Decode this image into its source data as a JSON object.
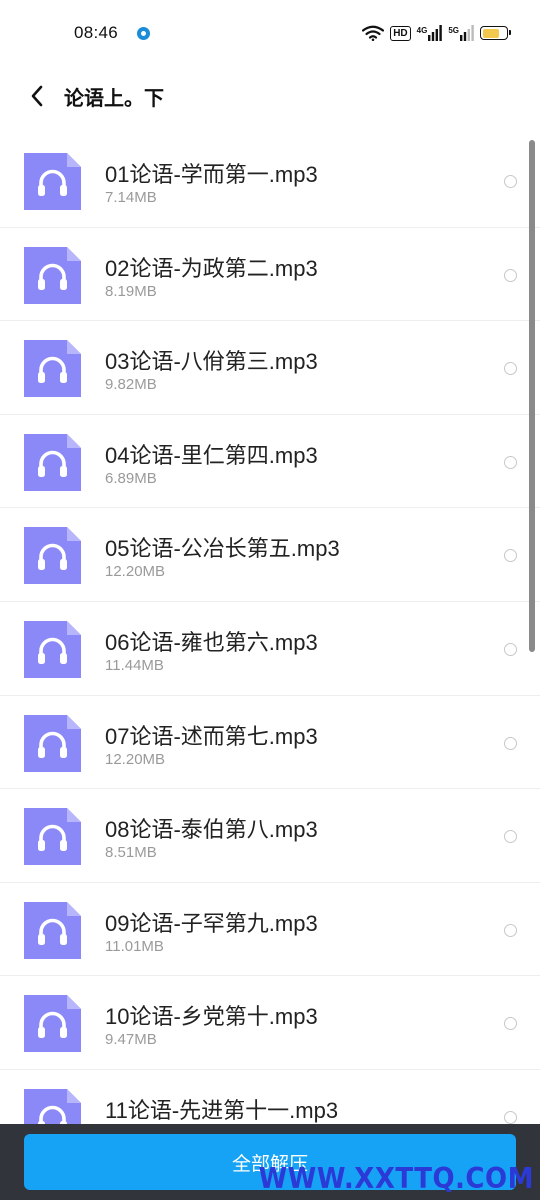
{
  "status_bar": {
    "time": "08:46",
    "network_hd": "HD",
    "network_1": "4G",
    "network_2": "5G",
    "battery_level": 0.7,
    "battery_color": "#f2c94c"
  },
  "header": {
    "back_icon": "chevron-left-icon",
    "title": "论语上。下"
  },
  "files": [
    {
      "name": "01论语-学而第一.mp3",
      "size": "7.14MB"
    },
    {
      "name": "02论语-为政第二.mp3",
      "size": "8.19MB"
    },
    {
      "name": "03论语-八佾第三.mp3",
      "size": "9.82MB"
    },
    {
      "name": "04论语-里仁第四.mp3",
      "size": "6.89MB"
    },
    {
      "name": "05论语-公冶长第五.mp3",
      "size": "12.20MB"
    },
    {
      "name": "06论语-雍也第六.mp3",
      "size": "11.44MB"
    },
    {
      "name": "07论语-述而第七.mp3",
      "size": "12.20MB"
    },
    {
      "name": "08论语-泰伯第八.mp3",
      "size": "8.51MB"
    },
    {
      "name": "09论语-子罕第九.mp3",
      "size": "11.01MB"
    },
    {
      "name": "10论语-乡党第十.mp3",
      "size": "9.47MB"
    },
    {
      "name": "11论语-先进第十一.mp3",
      "size": ""
    }
  ],
  "file_icon": "headphones-audio-file-icon",
  "colors": {
    "file_icon": "#8b88f7",
    "accent_button": "#17a3f5",
    "bottom_bar": "#32343b",
    "watermark": "#2b3ad6"
  },
  "bottom": {
    "extract_all_label": "全部解压"
  },
  "watermark": "WWW.XXTTQ.COM"
}
